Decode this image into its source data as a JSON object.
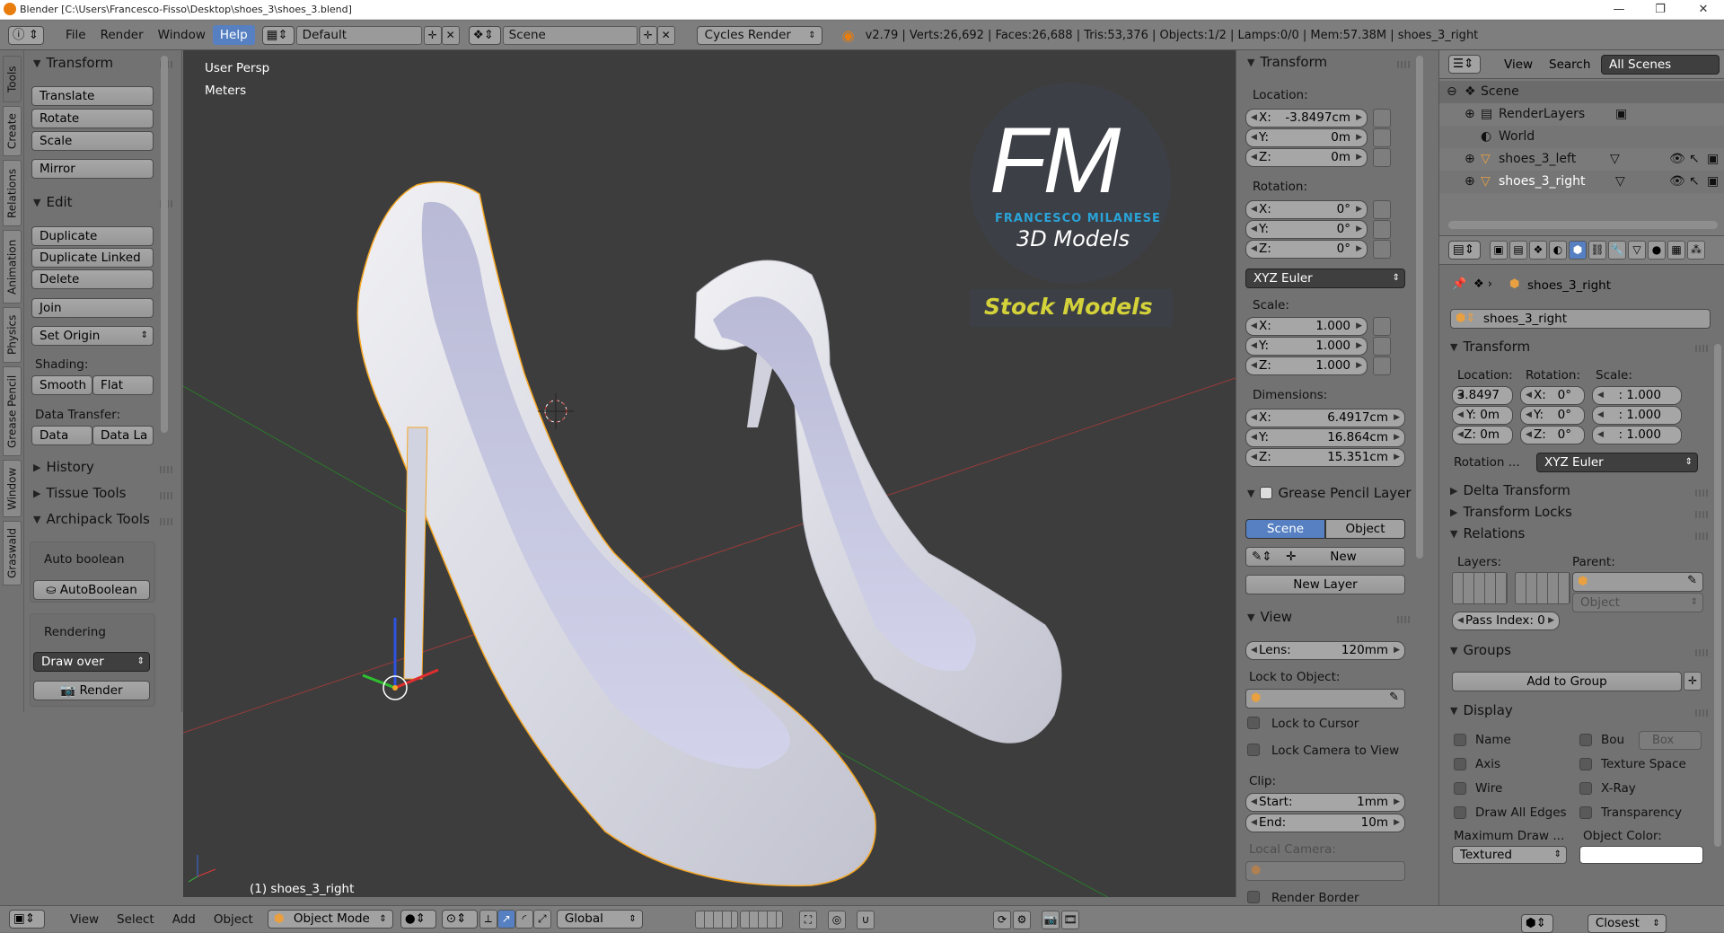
{
  "window": {
    "title": "Blender [C:\\Users\\Francesco-Fisso\\Desktop\\shoes_3\\shoes_3.blend]",
    "minimize": "—",
    "maximize": "❐",
    "close": "✕"
  },
  "menubar": {
    "items": [
      "File",
      "Render",
      "Window",
      "Help"
    ],
    "active": "Help",
    "layout": "Default",
    "scene": "Scene",
    "engine": "Cycles Render",
    "stats": "v2.79 | Verts:26,692 | Faces:26,688 | Tris:53,376 | Objects:1/2 | Lamps:0/0 | Mem:57.38M | shoes_3_right"
  },
  "tabs": [
    "Tools",
    "Create",
    "Relations",
    "Animation",
    "Physics",
    "Grease Pencil",
    "Window",
    "Graswald"
  ],
  "toolshelf": {
    "transform_title": "Transform",
    "translate": "Translate",
    "rotate": "Rotate",
    "scale": "Scale",
    "mirror": "Mirror",
    "edit_title": "Edit",
    "duplicate": "Duplicate",
    "duplicate_linked": "Duplicate Linked",
    "delete": "Delete",
    "join": "Join",
    "set_origin": "Set Origin",
    "shading_label": "Shading:",
    "smooth": "Smooth",
    "flat": "Flat",
    "data_transfer_label": "Data Transfer:",
    "data": "Data",
    "data_la": "Data La",
    "history": "History",
    "tissue": "Tissue Tools",
    "archipack": "Archipack Tools",
    "auto_boolean_label": "Auto boolean",
    "autoboolean": "AutoBoolean",
    "rendering_label": "Rendering",
    "draw_over": "Draw over",
    "render": "Render"
  },
  "viewport": {
    "view_name": "User Persp",
    "units": "Meters",
    "object_label": "(1) shoes_3_right",
    "watermark_letters": "FM",
    "watermark_name": "FRANCESCO MILANESE",
    "watermark_sub": "3D Models",
    "watermark_stock": "Stock Models"
  },
  "npanel": {
    "transform": "Transform",
    "location": "Location:",
    "loc": [
      {
        "k": "X:",
        "v": "-3.8497cm"
      },
      {
        "k": "Y:",
        "v": "0m"
      },
      {
        "k": "Z:",
        "v": "0m"
      }
    ],
    "rotation": "Rotation:",
    "rot": [
      {
        "k": "X:",
        "v": "0°"
      },
      {
        "k": "Y:",
        "v": "0°"
      },
      {
        "k": "Z:",
        "v": "0°"
      }
    ],
    "rotmode": "XYZ Euler",
    "scale": "Scale:",
    "scl": [
      {
        "k": "X:",
        "v": "1.000"
      },
      {
        "k": "Y:",
        "v": "1.000"
      },
      {
        "k": "Z:",
        "v": "1.000"
      }
    ],
    "dimensions": "Dimensions:",
    "dim": [
      {
        "k": "X:",
        "v": "6.4917cm"
      },
      {
        "k": "Y:",
        "v": "16.864cm"
      },
      {
        "k": "Z:",
        "v": "15.351cm"
      }
    ],
    "gp_layer": "Grease Pencil Layer",
    "scene": "Scene",
    "object": "Object",
    "new": "New",
    "new_layer": "New Layer",
    "view": "View",
    "lens_k": "Lens:",
    "lens_v": "120mm",
    "lock_to_object": "Lock to Object:",
    "lock_cursor": "Lock to Cursor",
    "lock_camera": "Lock Camera to View",
    "clip": "Clip:",
    "start_k": "Start:",
    "start_v": "1mm",
    "end_k": "End:",
    "end_v": "10m",
    "local_camera": "Local Camera:",
    "render_border": "Render Border"
  },
  "outliner": {
    "view": "View",
    "search": "Search",
    "filter": "All Scenes",
    "rows": [
      "Scene",
      "RenderLayers",
      "World",
      "shoes_3_left",
      "shoes_3_right"
    ]
  },
  "properties": {
    "object_path": "shoes_3_right",
    "object_name": "shoes_3_right",
    "transform": "Transform",
    "location": "Location:",
    "rotation": "Rotation:",
    "scale": "Scale:",
    "loc": [
      "3.8497",
      "Y:  0m",
      "Z:  0m"
    ],
    "rot": [
      {
        "k": "X:",
        "v": "0°"
      },
      {
        "k": "Y:",
        "v": "0°"
      },
      {
        "k": "Z:",
        "v": "0°"
      }
    ],
    "scl": [
      ": 1.000",
      ": 1.000",
      ": 1.000"
    ],
    "rotation_mode_label": "Rotation ...",
    "rotation_mode": "XYZ Euler",
    "delta": "Delta Transform",
    "locks": "Transform Locks",
    "relations": "Relations",
    "layers": "Layers:",
    "parent": "Parent:",
    "parent_type": "Object",
    "pass_index": "Pass Index:  0",
    "groups": "Groups",
    "add_group": "Add to Group",
    "display": "Display",
    "name": "Name",
    "bou": "Bou",
    "box": "Box",
    "axis": "Axis",
    "texture_space": "Texture Space",
    "wire": "Wire",
    "xray": "X-Ray",
    "draw_all_edges": "Draw All Edges",
    "transparency": "Transparency",
    "max_draw": "Maximum Draw ...",
    "object_color": "Object Color:",
    "textured": "Textured"
  },
  "bottombar": {
    "view": "View",
    "select": "Select",
    "add": "Add",
    "object": "Object",
    "mode": "Object Mode",
    "orientation": "Global",
    "snap": "Closest"
  },
  "colors": {
    "accent": "#5680c2",
    "viewport_bg": "#3d3d3d",
    "panel_bg": "#727272",
    "selection": "#f5a623",
    "shoe": "#d9dae2",
    "watermark_blue": "#2aa3d8",
    "watermark_yellow": "#d4d23a"
  }
}
